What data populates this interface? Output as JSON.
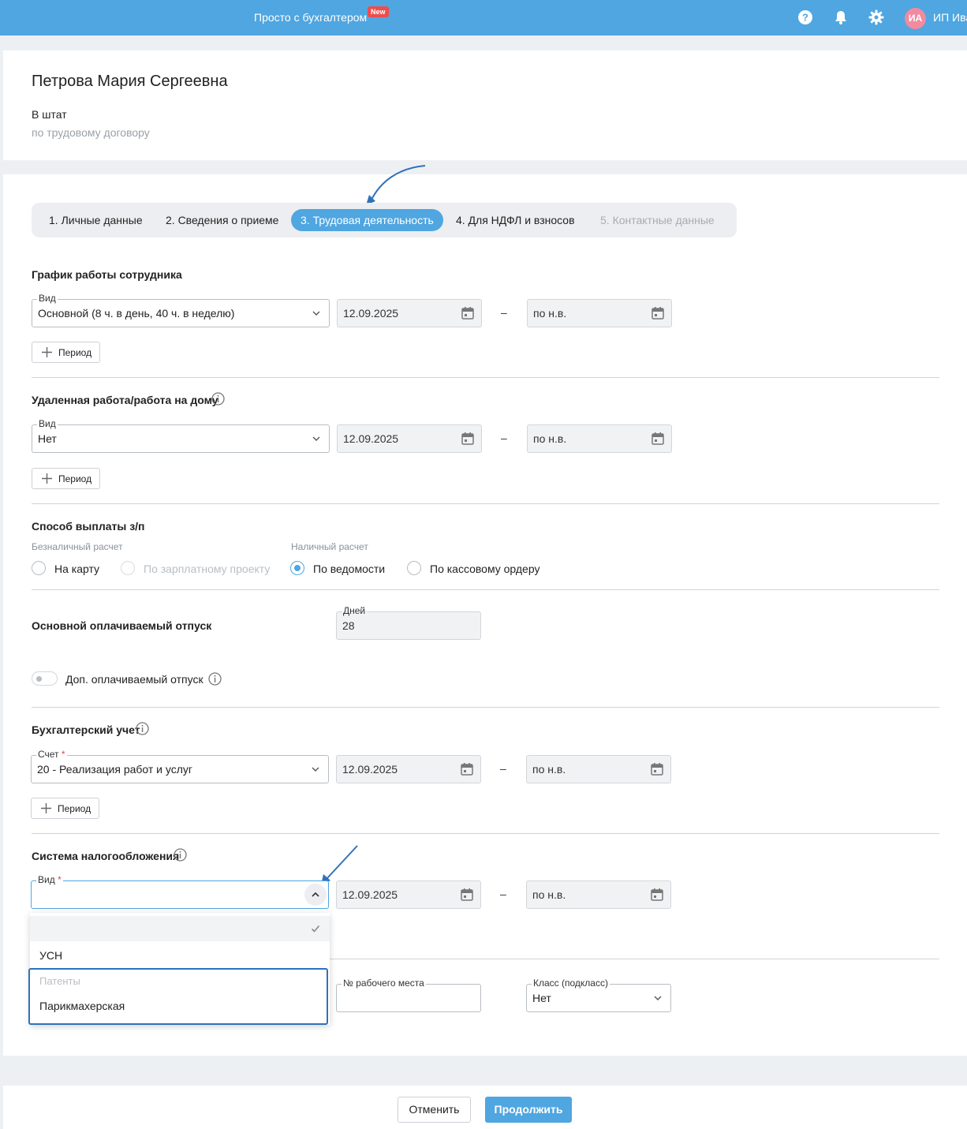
{
  "header": {
    "brand": "Просто с бухгалтером",
    "new_badge": "New",
    "icons": [
      "help-icon",
      "bell-icon",
      "gear-icon"
    ],
    "avatar_initials": "ИА",
    "user_name": "ИП Ива"
  },
  "employee": {
    "name": "Петрова Мария Сергеевна",
    "type": "В штат",
    "contract": "по трудовому договору"
  },
  "tabs": [
    {
      "label": "1. Личные данные",
      "state": "normal"
    },
    {
      "label": "2. Сведения о приеме",
      "state": "normal"
    },
    {
      "label": "3. Трудовая деятельность",
      "state": "active"
    },
    {
      "label": "4. Для НДФЛ и взносов",
      "state": "normal"
    },
    {
      "label": "5. Контактные данные",
      "state": "disabled"
    }
  ],
  "schedule": {
    "title": "График работы сотрудника",
    "kind_label": "Вид",
    "kind_value": "Основной (8 ч. в день, 40 ч. в неделю)",
    "date_from": "12.09.2025",
    "date_to": "по н.в.",
    "period_button": "Период"
  },
  "remote": {
    "title": "Удаленная работа/работа на дому",
    "kind_label": "Вид",
    "kind_value": "Нет",
    "date_from": "12.09.2025",
    "date_to": "по н.в.",
    "period_button": "Период"
  },
  "payment": {
    "title": "Способ выплаты з/п",
    "cashless_caption": "Безналичный расчет",
    "cash_caption": "Наличный расчет",
    "options": [
      {
        "label": "На карту",
        "checked": false,
        "disabled": false
      },
      {
        "label": "По зарплатному проекту",
        "checked": false,
        "disabled": true
      },
      {
        "label": "По ведомости",
        "checked": true,
        "disabled": false
      },
      {
        "label": "По кассовому ордеру",
        "checked": false,
        "disabled": false
      }
    ]
  },
  "vacation": {
    "title": "Основной оплачиваемый отпуск",
    "days_label": "Дней",
    "days_value": "28",
    "extra_toggle_label": "Доп. оплачиваемый отпуск",
    "extra_toggle_on": false
  },
  "accounting": {
    "title": "Бухгалтерский учет",
    "account_label": "Счет",
    "account_value": "20 - Реализация работ и услуг",
    "date_from": "12.09.2025",
    "date_to": "по н.в.",
    "period_button": "Период"
  },
  "tax": {
    "title": "Система налогообложения",
    "kind_label": "Вид",
    "kind_value": "",
    "date_from": "12.09.2025",
    "date_to": "по н.в.",
    "dropdown": {
      "options": [
        "",
        "УСН"
      ],
      "group_label": "Патенты",
      "group_options": [
        "Парикмахерская"
      ],
      "selected_index": 0
    }
  },
  "workplace": {
    "number_label": "№ рабочего места",
    "number_value": "",
    "class_label": "Класс (подкласс)",
    "class_value": "Нет"
  },
  "dash": "–",
  "footer": {
    "cancel": "Отменить",
    "continue": "Продолжить"
  },
  "colors": {
    "accent": "#4fa6e0",
    "header_bg": "#4fa6e0",
    "new_badge": "#ef4d4d",
    "avatar": "#f28aa0",
    "annotation_arrow": "#2f72b8"
  }
}
